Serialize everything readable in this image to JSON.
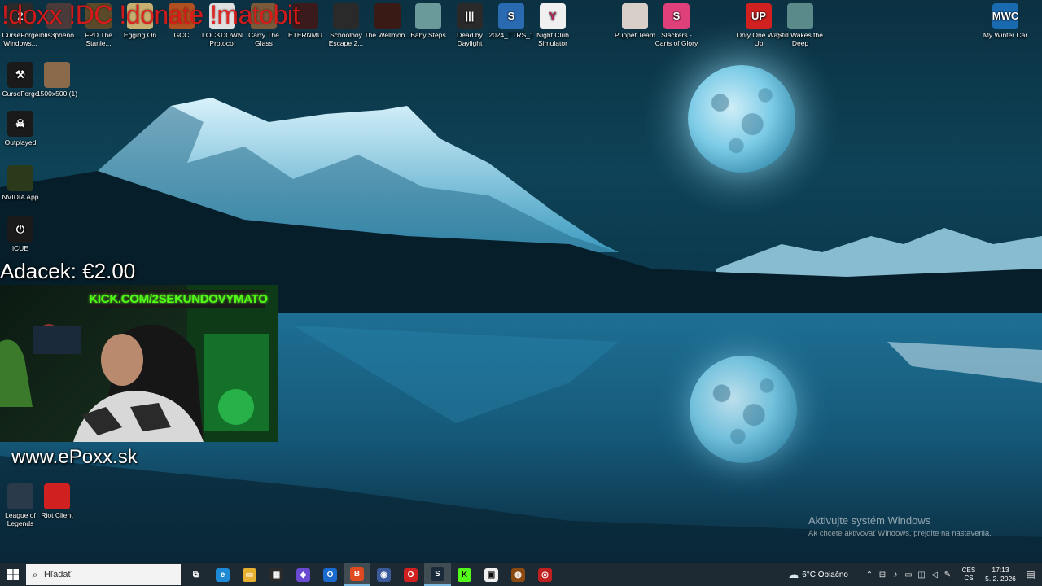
{
  "overlay": {
    "commands": "!doxx !DC !donate !matobit",
    "donation": "Adacek: €2.00",
    "kick_banner": "KICK.COM/2SEKUNDOVYMATO",
    "website": "www.ePoxx.sk"
  },
  "desktop_icons": [
    {
      "label": "CurseForge Windows...",
      "icon": "curseforge-icon",
      "color": "#2b2b2b",
      "glyph": "2"
    },
    {
      "label": "iblis3pheno...",
      "icon": "file-icon",
      "color": "#4a3a3a",
      "glyph": ""
    },
    {
      "label": "FPD The Stanle...",
      "icon": "game-icon",
      "color": "#5a4a2a",
      "glyph": ""
    },
    {
      "label": "Egging On",
      "icon": "egg-icon",
      "color": "#c8b070",
      "glyph": ""
    },
    {
      "label": "GCC",
      "icon": "gcc-icon",
      "color": "#b05020",
      "glyph": ""
    },
    {
      "label": "LOCKDOWN Protocol",
      "icon": "lockdown-icon",
      "color": "#e0e0e0",
      "glyph": ""
    },
    {
      "label": "Carry The Glass",
      "icon": "glass-icon",
      "color": "#7a5a3a",
      "glyph": ""
    },
    {
      "label": "ETERNMU",
      "icon": "eternmu-icon",
      "color": "#3a1a1a",
      "glyph": ""
    },
    {
      "label": "Schoolboy Escape 2...",
      "icon": "schoolboy-icon",
      "color": "#2a2a2a",
      "glyph": ""
    },
    {
      "label": "The Wellmon...",
      "icon": "wellmon-icon",
      "color": "#3a1a14",
      "glyph": ""
    },
    {
      "label": "Baby Steps",
      "icon": "baby-steps-icon",
      "color": "#6a9a9a",
      "glyph": ""
    },
    {
      "label": "Dead by Daylight",
      "icon": "dbd-icon",
      "color": "#2a2a2a",
      "glyph": "|||"
    },
    {
      "label": "2024_TTRS_1",
      "icon": "ttrs-icon",
      "color": "#2a6ab0",
      "glyph": "S"
    },
    {
      "label": "Night Club Simulator",
      "icon": "nightclub-icon",
      "color": "#f0f0f0",
      "glyph": "Y"
    },
    {
      "label": "Puppet Team",
      "icon": "puppet-icon",
      "color": "#d8d0c8",
      "glyph": ""
    },
    {
      "label": "Slackers - Carts of Glory",
      "icon": "slackers-icon",
      "color": "#e0407a",
      "glyph": "S"
    },
    {
      "label": "Only One Way Up",
      "icon": "onlyup-icon",
      "color": "#d02020",
      "glyph": "UP"
    },
    {
      "label": "Still Wakes the Deep",
      "icon": "stillwakes-icon",
      "color": "#5a8a8a",
      "glyph": ""
    },
    {
      "label": "My Winter Car",
      "icon": "mywintercar-icon",
      "color": "#1a6ab0",
      "glyph": "MWC"
    },
    {
      "label": "CurseForge",
      "icon": "curseforge-app-icon",
      "color": "#1a1a1a",
      "glyph": "⚒"
    },
    {
      "label": "1500x500 (1)",
      "icon": "image-file-icon",
      "color": "#8a6a4a",
      "glyph": ""
    },
    {
      "label": "Outplayed",
      "icon": "outplayed-icon",
      "color": "#1a1a1a",
      "glyph": "☠"
    },
    {
      "label": "NVIDIA App",
      "icon": "nvidia-icon",
      "color": "#2a3a1a",
      "glyph": ""
    },
    {
      "label": "iCUE",
      "icon": "icue-icon",
      "color": "#1a1a1a",
      "glyph": "⏻"
    },
    {
      "label": "League of Legends",
      "icon": "lol-icon",
      "color": "#2a3a4a",
      "glyph": ""
    },
    {
      "label": "Riot Client",
      "icon": "riot-icon",
      "color": "#d02020",
      "glyph": ""
    }
  ],
  "watermark": {
    "title": "Aktivujte systém Windows",
    "subtitle": "Ak chcete aktivovať Windows, prejdite na nastavenia."
  },
  "taskbar": {
    "search_placeholder": "Hľadať",
    "apps": [
      {
        "name": "task-view",
        "color": "#1d2a33",
        "glyph": "⧉"
      },
      {
        "name": "edge",
        "color": "#1e8ad6",
        "glyph": "e"
      },
      {
        "name": "file-explorer",
        "color": "#e8b030",
        "glyph": "▭"
      },
      {
        "name": "store",
        "color": "#2a2a2a",
        "glyph": "▦"
      },
      {
        "name": "copilot",
        "color": "#6a4ad0",
        "glyph": "◆"
      },
      {
        "name": "outlook",
        "color": "#1a6ad0",
        "glyph": "O"
      },
      {
        "name": "brave",
        "color": "#e04a20",
        "glyph": "B"
      },
      {
        "name": "app-blue",
        "color": "#3a5a9a",
        "glyph": "◉"
      },
      {
        "name": "opera",
        "color": "#d02020",
        "glyph": "O"
      },
      {
        "name": "steam",
        "color": "#1a2a3a",
        "glyph": "S"
      },
      {
        "name": "kick",
        "color": "#53fc18",
        "glyph": "K"
      },
      {
        "name": "app-white",
        "color": "#f0f0f0",
        "glyph": "▣"
      },
      {
        "name": "app-orange",
        "color": "#8a4a10",
        "glyph": "◍"
      },
      {
        "name": "app-red",
        "color": "#c02020",
        "glyph": "◎"
      }
    ],
    "weather": "6°C Oblačno",
    "language_top": "CES",
    "language_bottom": "CS",
    "time": "17:13",
    "date": "5. 2. 2026"
  }
}
